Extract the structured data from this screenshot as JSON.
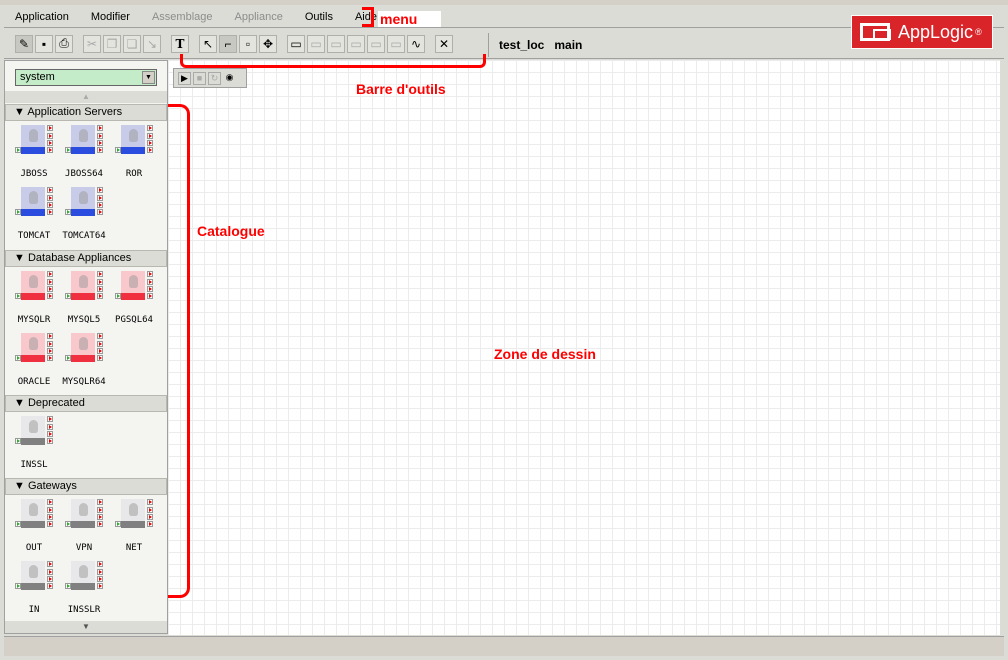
{
  "menu": [
    "Application",
    "Modifier",
    "Assemblage",
    "Appliance",
    "Outils",
    "Aide"
  ],
  "menu_disabled": [
    false,
    false,
    true,
    true,
    false,
    false
  ],
  "context": {
    "application": "test_loc",
    "assembly": "main"
  },
  "logo": {
    "text": "AppLogic",
    "mark": "®"
  },
  "catalog": {
    "selected": "system",
    "categories": [
      {
        "name": "Application Servers",
        "color": "blue",
        "items": [
          "JBOSS",
          "JBOSS64",
          "ROR",
          "TOMCAT",
          "TOMCAT64"
        ]
      },
      {
        "name": "Database Appliances",
        "color": "red",
        "items": [
          "MYSQLR",
          "MYSQL5",
          "PGSQL64",
          "ORACLE",
          "MYSQLR64"
        ]
      },
      {
        "name": "Deprecated",
        "color": "gray",
        "items": [
          "INSSL"
        ]
      },
      {
        "name": "Gateways",
        "color": "gray",
        "items": [
          "OUT",
          "VPN",
          "NET",
          "IN",
          "INSSLR"
        ]
      }
    ]
  },
  "annotations": {
    "menu": "menu",
    "toolbar": "Barre d'outils",
    "catalog": "Catalogue",
    "canvas": "Zone de dessin"
  }
}
